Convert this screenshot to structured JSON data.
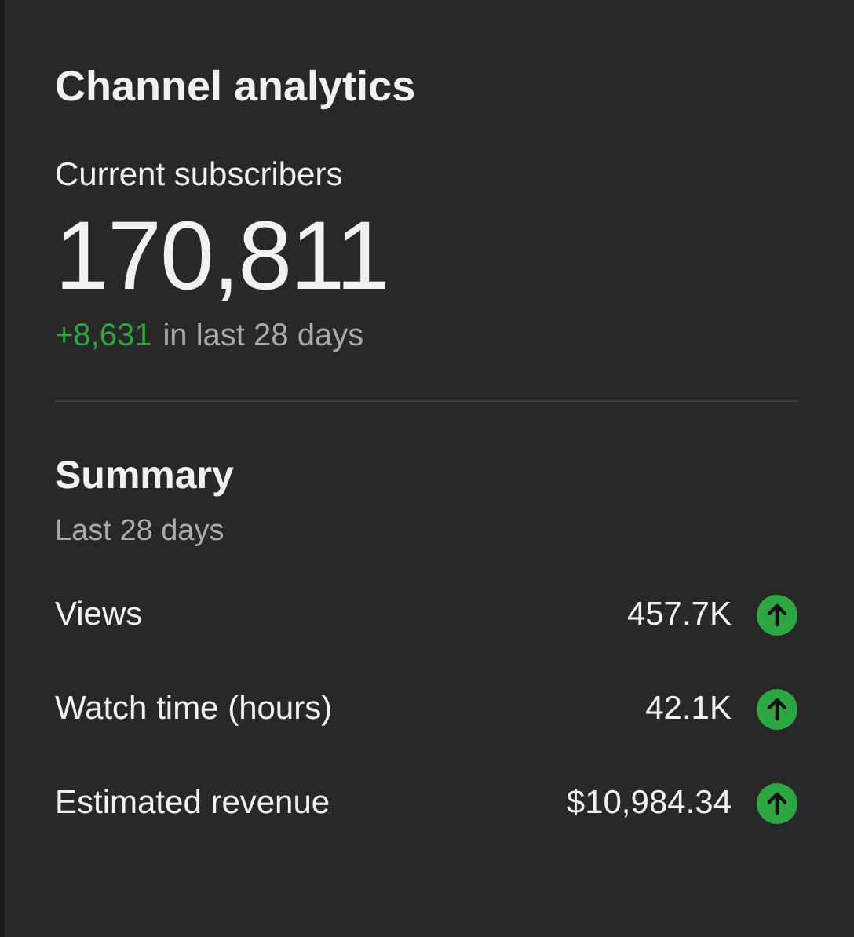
{
  "card": {
    "title": "Channel analytics"
  },
  "subscribers": {
    "label": "Current subscribers",
    "count": "170,811",
    "change": "+8,631",
    "change_period": "in last 28 days"
  },
  "summary": {
    "title": "Summary",
    "period": "Last 28 days",
    "metrics": [
      {
        "label": "Views",
        "value": "457.7K",
        "kind": "rising"
      },
      {
        "label": "Watch time (hours)",
        "value": "42.1K",
        "kind": "rising"
      },
      {
        "label": "Estimated revenue",
        "value": "$10,984.34",
        "kind": "rising"
      }
    ]
  }
}
